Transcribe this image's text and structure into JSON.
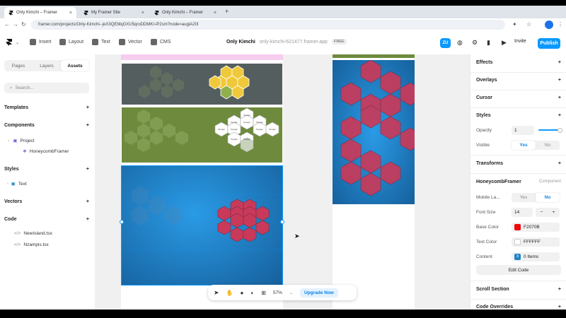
{
  "browser": {
    "tabs": [
      {
        "title": "Only Kimchi – Framer",
        "active": true
      },
      {
        "title": "My Framer Site",
        "active": false
      },
      {
        "title": "Only Kimchi – Framer",
        "active": false
      }
    ],
    "url": "framer.com/projects/Only-Kimchi--jeX3QEMqGXU5qroDDMKI-iP2sm?node=augiA20l"
  },
  "toolbar": {
    "insert": "Insert",
    "layout": "Layout",
    "text": "Text",
    "vector": "Vector",
    "cms": "CMS",
    "project_name": "Only Kimchi",
    "domain": "only-kimchi-621477.framer.app",
    "plan": "FREE",
    "avatar": "ZU",
    "invite": "Invite",
    "publish": "Publish"
  },
  "left": {
    "tabs": [
      "Pages",
      "Layers",
      "Assets"
    ],
    "active_tab": "Assets",
    "search_placeholder": "Search...",
    "sections": {
      "templates": "Templates",
      "components": "Components",
      "project": "Project",
      "honeycomb": "HoneycombFramer",
      "styles": "Styles",
      "text": "Text",
      "vectors": "Vectors",
      "code": "Code",
      "file1": "NewIsland.tsx",
      "file2": "Nzampis.tsx"
    }
  },
  "canvas": {
    "zoom": "57%",
    "upgrade": "Upgrade Now",
    "honeycomb_labels": [
      "Hexagon",
      "Hexagon",
      "Hexagon",
      "Hexagon",
      "Hexagon",
      "Hexagon",
      "Hexagon",
      "Hexagon",
      "Hexagon",
      "Hexagon"
    ],
    "colors": {
      "yellow": "#F0C93A",
      "green": "#6E8B3D",
      "red": "#C93A5A",
      "blue": "#1F83C9"
    }
  },
  "right": {
    "effects": "Effects",
    "overlays": "Overlays",
    "cursor": "Cursor",
    "styles": "Styles",
    "opacity_label": "Opacity",
    "opacity_value": "1",
    "visible_label": "Visible",
    "yes": "Yes",
    "no": "No",
    "transforms": "Transforms",
    "component_name": "HoneycombFramer",
    "component_tag": "Component",
    "mobile_label": "Mobile La...",
    "font_size_label": "Font Size",
    "font_size_value": "14",
    "base_color_label": "Base Color",
    "base_color_value": "F2070B",
    "text_color_label": "Text Color",
    "text_color_value": "FFFFFF",
    "content_label": "Content",
    "content_value": "0 Items",
    "edit_code": "Edit Code",
    "scroll_section": "Scroll Section",
    "code_overrides": "Code Overrides",
    "base_color_hex": "#F2070B",
    "text_color_hex": "#FFFFFF"
  }
}
